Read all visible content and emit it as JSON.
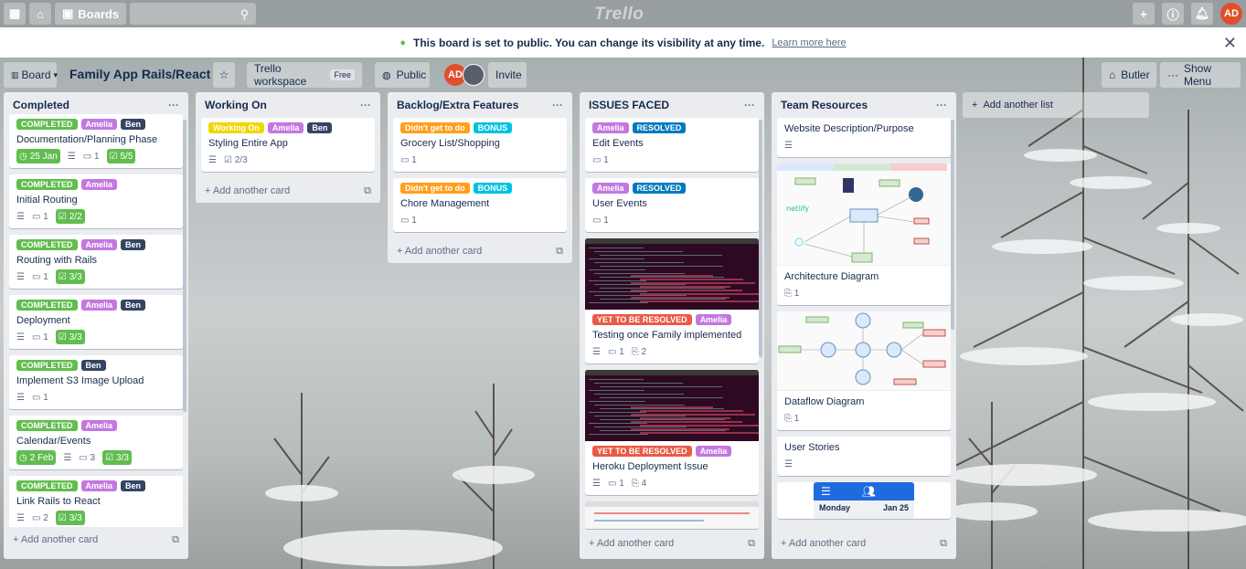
{
  "topbar": {
    "boards_label": "Boards",
    "logo": "Trello",
    "user_initials": "AD"
  },
  "banner": {
    "message": "This board is set to public. You can change its visibility at any time.",
    "link": "Learn more here"
  },
  "header": {
    "board_btn": "Board",
    "title": "Family App Rails/React",
    "workspace": "Trello workspace",
    "workspace_badge": "Free",
    "visibility": "Public",
    "member1": "AD",
    "invite": "Invite",
    "butler": "Butler",
    "show_menu": "Show Menu"
  },
  "add_card": "Add another card",
  "add_list": "Add another list",
  "lists": [
    {
      "title": "Completed",
      "cards": [
        {
          "labels": [
            {
              "t": "COMPLETED",
              "c": "green"
            },
            {
              "t": "Amelia",
              "c": "purple"
            },
            {
              "t": "Ben",
              "c": "navy"
            }
          ],
          "title": "Documentation/Planning Phase",
          "due": "25 Jan",
          "comments": "1",
          "check": "5/5"
        },
        {
          "labels": [
            {
              "t": "COMPLETED",
              "c": "green"
            },
            {
              "t": "Amelia",
              "c": "purple"
            }
          ],
          "title": "Initial Routing",
          "comments": "1",
          "check": "2/2"
        },
        {
          "labels": [
            {
              "t": "COMPLETED",
              "c": "green"
            },
            {
              "t": "Amelia",
              "c": "purple"
            },
            {
              "t": "Ben",
              "c": "navy"
            }
          ],
          "title": "Routing with Rails",
          "comments": "1",
          "check": "3/3"
        },
        {
          "labels": [
            {
              "t": "COMPLETED",
              "c": "green"
            },
            {
              "t": "Amelia",
              "c": "purple"
            },
            {
              "t": "Ben",
              "c": "navy"
            }
          ],
          "title": "Deployment",
          "comments": "1",
          "check": "3/3"
        },
        {
          "labels": [
            {
              "t": "COMPLETED",
              "c": "green"
            },
            {
              "t": "Ben",
              "c": "navy"
            }
          ],
          "title": "Implement S3 Image Upload",
          "comments": "1"
        },
        {
          "labels": [
            {
              "t": "COMPLETED",
              "c": "green"
            },
            {
              "t": "Amelia",
              "c": "purple"
            }
          ],
          "title": "Calendar/Events",
          "due": "2 Feb",
          "comments": "3",
          "check": "3/3"
        },
        {
          "labels": [
            {
              "t": "COMPLETED",
              "c": "green"
            },
            {
              "t": "Amelia",
              "c": "purple"
            },
            {
              "t": "Ben",
              "c": "navy"
            }
          ],
          "title": "Link Rails to React",
          "comments": "2",
          "check": "3/3"
        }
      ]
    },
    {
      "title": "Working On",
      "cards": [
        {
          "labels": [
            {
              "t": "Working On",
              "c": "yellow"
            },
            {
              "t": "Amelia",
              "c": "purple"
            },
            {
              "t": "Ben",
              "c": "navy"
            }
          ],
          "title": "Styling Entire App",
          "check_plain": "2/3"
        }
      ]
    },
    {
      "title": "Backlog/Extra Features",
      "cards": [
        {
          "labels": [
            {
              "t": "Didn't get to do",
              "c": "orange"
            },
            {
              "t": "BONUS",
              "c": "sky"
            }
          ],
          "title": "Grocery List/Shopping",
          "comments": "1"
        },
        {
          "labels": [
            {
              "t": "Didn't get to do",
              "c": "orange"
            },
            {
              "t": "BONUS",
              "c": "sky"
            }
          ],
          "title": "Chore Management",
          "comments": "1"
        }
      ]
    },
    {
      "title": "ISSUES FACED",
      "cards": [
        {
          "labels": [
            {
              "t": "Amelia",
              "c": "purple"
            },
            {
              "t": "RESOLVED",
              "c": "blue"
            }
          ],
          "title": "Edit Events",
          "comments": "1"
        },
        {
          "labels": [
            {
              "t": "Amelia",
              "c": "purple"
            },
            {
              "t": "RESOLVED",
              "c": "blue"
            }
          ],
          "title": "User Events",
          "comments": "1"
        },
        {
          "labels": [
            {
              "t": "YET TO BE RESOLVED",
              "c": "red"
            },
            {
              "t": "Amelia",
              "c": "purple"
            }
          ],
          "title": "Testing once Family implemented",
          "comments": "1",
          "attach": "2"
        },
        {
          "labels": [
            {
              "t": "YET TO BE RESOLVED",
              "c": "red"
            },
            {
              "t": "Amelia",
              "c": "purple"
            }
          ],
          "title": "Heroku Deployment Issue",
          "comments": "1",
          "attach": "4"
        }
      ]
    },
    {
      "title": "Team Resources",
      "cards": [
        {
          "title": "Website Description/Purpose"
        },
        {
          "title": "Architecture Diagram",
          "attach": "1"
        },
        {
          "title": "Dataflow Diagram",
          "attach": "1"
        },
        {
          "title": "User Stories"
        }
      ],
      "partial_card": {
        "day": "Monday",
        "date": "Jan 25"
      }
    }
  ],
  "colors": {
    "green": "#61bd4f",
    "purple": "#c377e0",
    "navy": "#344563",
    "yellow": "#f2d600",
    "orange": "#ff9f1a",
    "sky": "#00c2e0",
    "blue": "#0079bf",
    "red": "#eb5a46"
  }
}
